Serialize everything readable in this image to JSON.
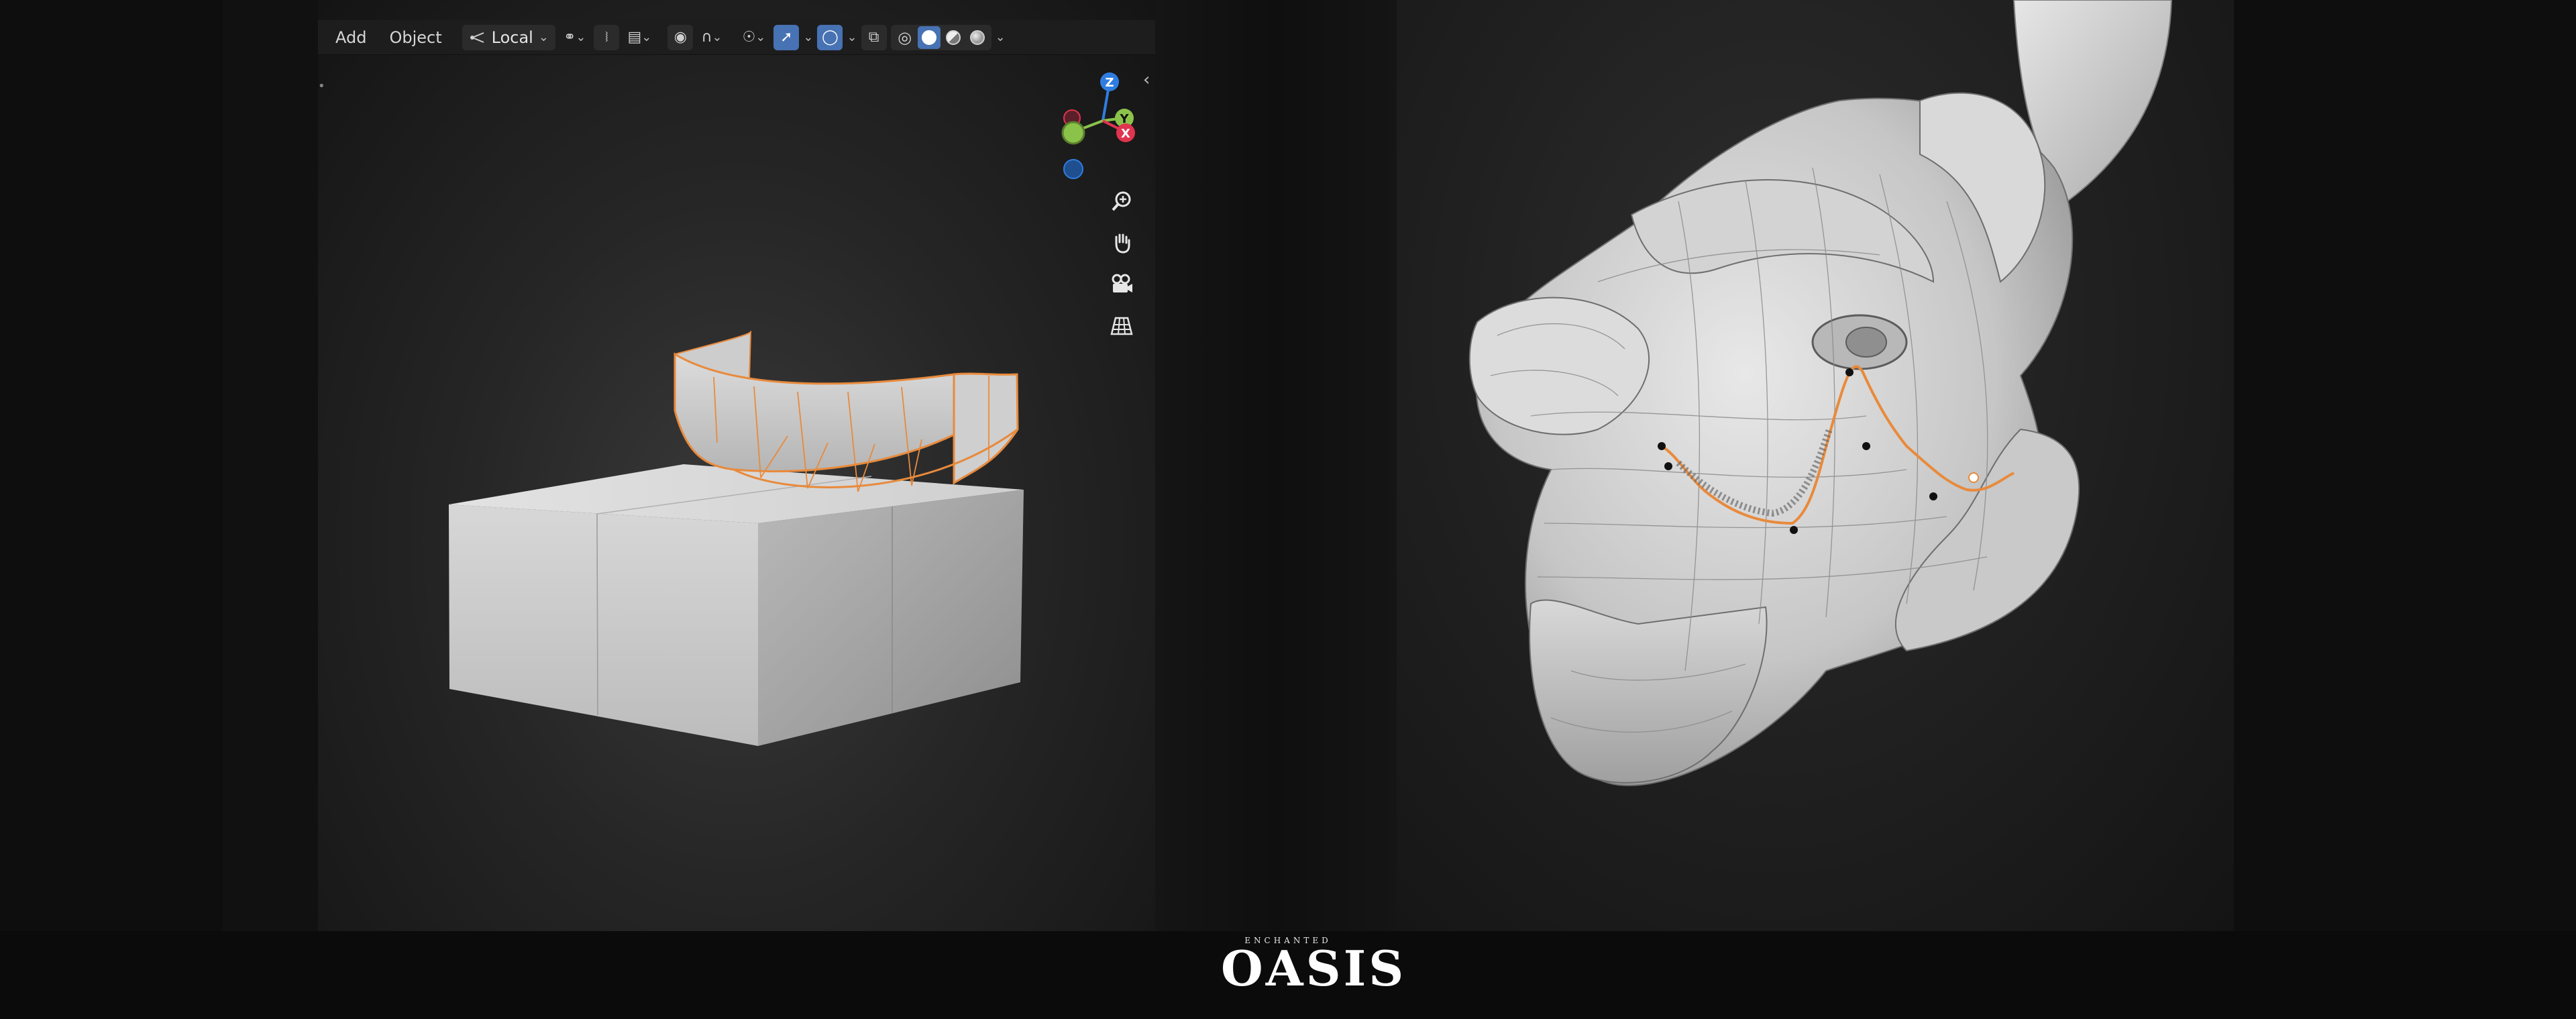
{
  "viewport_left": {
    "header": {
      "menus": [
        {
          "label": "Add"
        },
        {
          "label": "Object"
        }
      ],
      "transform_orientation": {
        "value": "Local"
      },
      "icons": [
        "pivot-icon",
        "link-icon",
        "snap-icon",
        "snap-increment-icon",
        "proportional-edit-icon",
        "falloff-icon",
        "visibility-icon",
        "gizmo-icon",
        "overlay-icon",
        "xray-icon",
        "wireframe-shading-icon",
        "solid-shading-icon",
        "material-shading-icon",
        "rendered-shading-icon"
      ]
    },
    "gizmo": {
      "axes": [
        {
          "label": "Z",
          "color": "#2f7de1"
        },
        {
          "label": "Y",
          "color": "#8bc34a"
        },
        {
          "label": "X",
          "color": "#e0344f"
        }
      ]
    },
    "navigation": [
      "zoom-icon",
      "pan-hand-icon",
      "camera-view-icon",
      "perspective-grid-icon"
    ],
    "colors": {
      "selection": "#e88a3c",
      "header": "#1d1d1d",
      "active_button": "#4772b3"
    }
  },
  "viewport_right": {
    "subject": "sculpted-creature-head",
    "curve_color": "#e88a3c"
  },
  "logo": {
    "top_text": "ENCHANTED",
    "main_text": "OASIS"
  }
}
